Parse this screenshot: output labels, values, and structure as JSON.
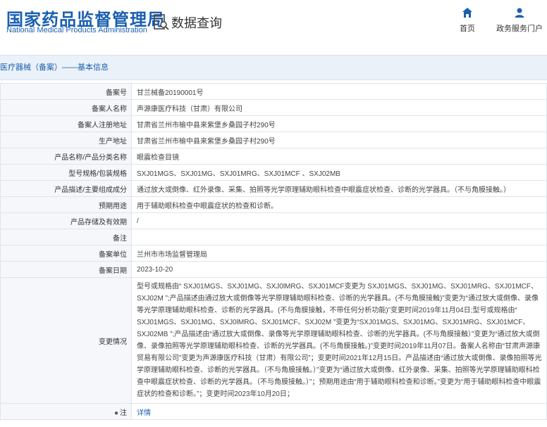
{
  "header": {
    "logo_cn": "国家药品监督管理局",
    "logo_en": "National Medical Products Administration",
    "query_title": "数据查询",
    "nav": [
      {
        "label": "首页",
        "icon": "home-icon"
      },
      {
        "label": "政务服务门户",
        "icon": "user-icon"
      }
    ]
  },
  "breadcrumb": "医疗器械（备案）——基本信息",
  "colors": {
    "brand": "#1a5fb0",
    "label_bg": "#f5f7fa",
    "crumb_bg": "#eaf1f8"
  },
  "rows": [
    {
      "label": "备案号",
      "value": "甘兰械备20190001号"
    },
    {
      "label": "备案人名称",
      "value": "声源康医疗科技（甘肃）有限公司"
    },
    {
      "label": "备案人注册地址",
      "value": "甘肃省兰州市榆中县来紫堡乡桑园子村290号"
    },
    {
      "label": "生产地址",
      "value": "甘肃省兰州市榆中县来紫堡乡桑园子村290号"
    },
    {
      "label": "产品名称/产品分类名称",
      "value": "眼震检查目镜"
    },
    {
      "label": "型号规格/包装规格",
      "value": "SXJ01MGS、SXJ01MG、SXJ01MRG、SXJ01MCF 、SXJ02MB"
    },
    {
      "label": "产品描述/主要组成成分",
      "value": "通过放大或倒像、红外录像、采集、拍照等光学原理辅助眼科检查中眼震症状检查、诊断的光学器具。（不与角膜接触。）"
    },
    {
      "label": "预期用途",
      "value": "用于辅助眼科检查中眼震症状的检查和诊断。"
    },
    {
      "label": "产品存储及有效期",
      "value": "/"
    },
    {
      "label": "备注",
      "value": ""
    },
    {
      "label": "备案单位",
      "value": "兰州市市场监督管理局"
    },
    {
      "label": "备案日期",
      "value": "2023-10-20"
    },
    {
      "label": "变更情况",
      "value": "型号或规格由“ SXJ01MGS、SXJ01MG、SXJ0lMRG、SXJ01MCF变更为 SXJ01MGS、SXJ01MG、SXJ01MRG、SXJ01MCF、SXJ02M ”;产品描述由通过放大或倒像等光学原理辅助眼科检查、诊断的光学器具。(不与角膜接触)”变更为“通过放大或倒像、录像等光学原理辅助眼科检查、诊断的光学器具。(不与角膜接触，不带任何分析功能)”变更时间2019年11月04日;型号或规格由“ SXJ01MGS、SXJ01MG、SXJ0lMRG、SXJ01MCF、SXJ02M ”变更为“SXJ01MGS、SXJ01MG、SXJ01MRG、SXJ01MCF、SXJ02MB ”;产品描述由“通过放大或倒像、录像等光学原理辅助眼科检查、诊断的光学器具。(不与角膜接触）”变更为“通过放大或倒像、录像拍照等光学原理辅助眼科检查、诊断的光学器具。(不与角膜接触。)”变更时间2019年11月07日。备案人名称由“甘肃声源康贸易有限公司”变更为声源康医疗科技（甘肃）有限公司”；变更时间2021年12月15日。产品描述由“通过放大或倒像、录像拍照等光学原理辅助眼科检查、诊断的光学器具。（不与角膜接触。）”变更为“通过放大或倒像、红外录像、采集、拍照等光学原理辅助眼科检查中眼震症状检查、诊断的光学器具。（不与角膜接触。）”；预期用途由“用于辅助眼科检查和诊断。”变更为“用于辅助眼科检查中眼震症状的检查和诊断。”；变更时间2023年10月20日；"
    },
    {
      "label": "注",
      "value": "详情"
    }
  ]
}
